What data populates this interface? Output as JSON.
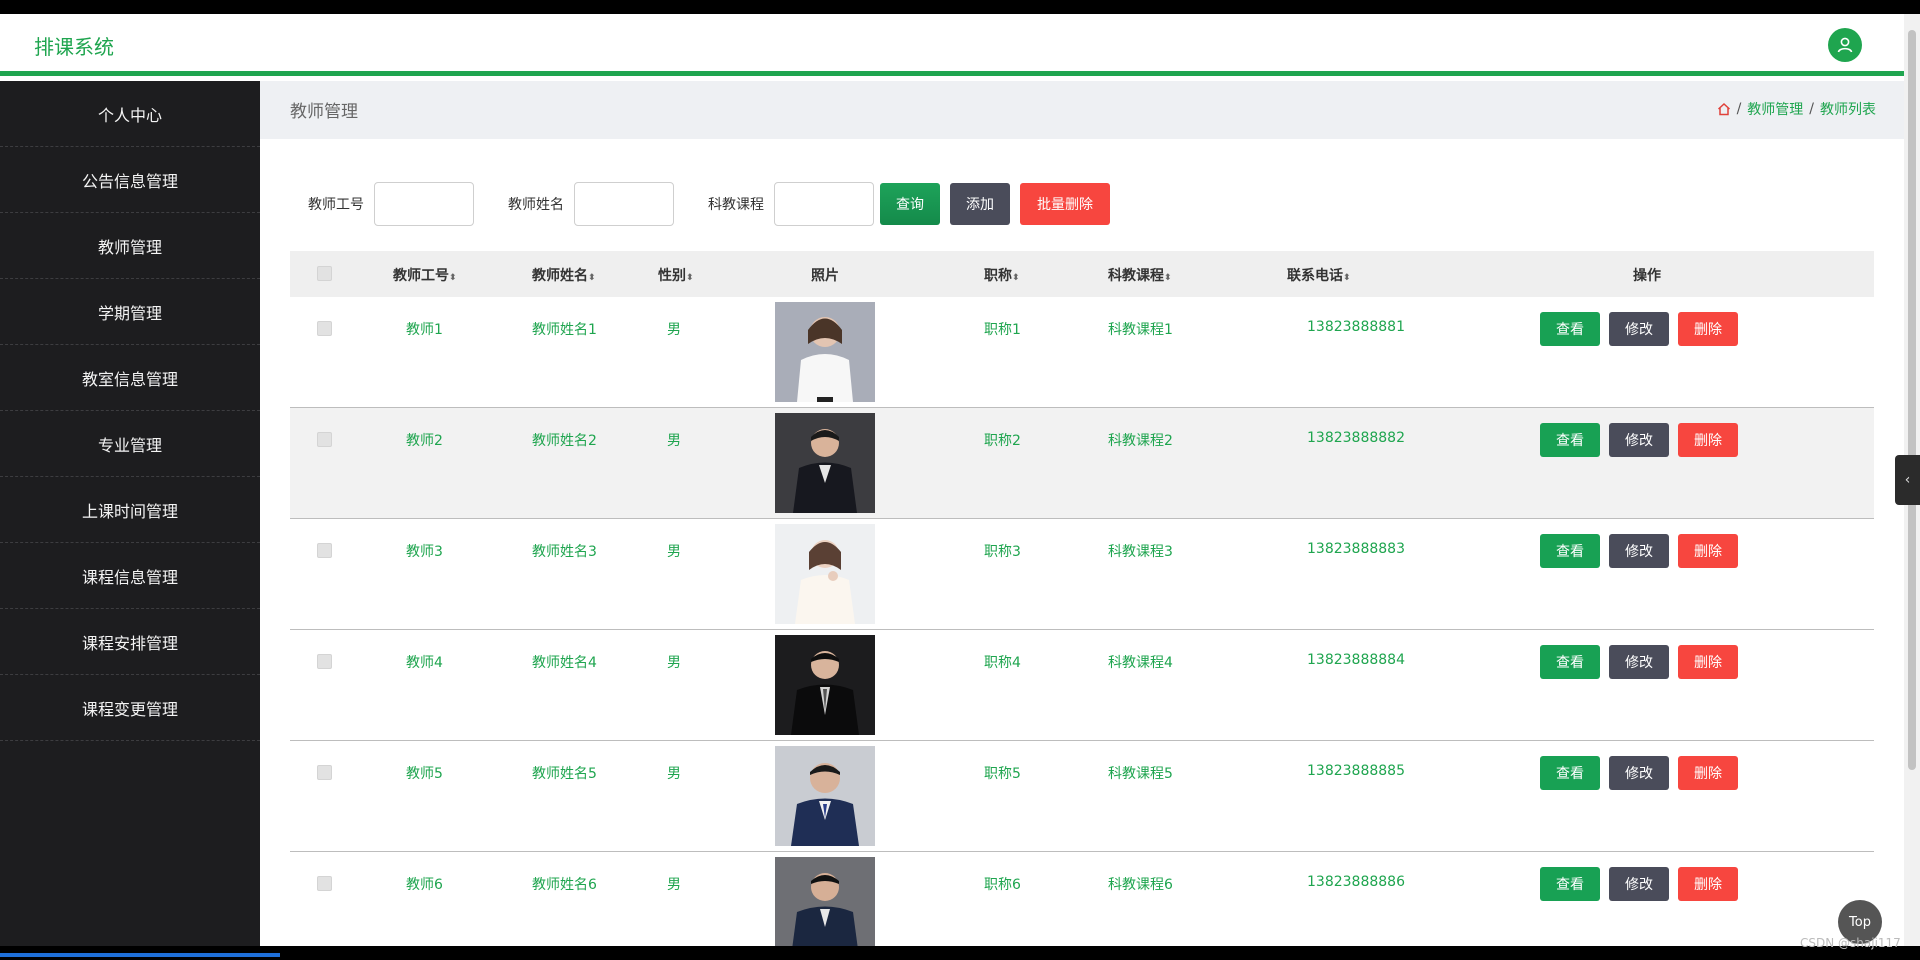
{
  "app": {
    "title": "排课系统"
  },
  "sidebar": {
    "items": [
      {
        "label": "个人中心"
      },
      {
        "label": "公告信息管理"
      },
      {
        "label": "教师管理"
      },
      {
        "label": "学期管理"
      },
      {
        "label": "教室信息管理"
      },
      {
        "label": "专业管理"
      },
      {
        "label": "上课时间管理"
      },
      {
        "label": "课程信息管理"
      },
      {
        "label": "课程安排管理"
      },
      {
        "label": "课程变更管理"
      }
    ]
  },
  "page": {
    "title": "教师管理",
    "breadcrumb": [
      "教师管理",
      "教师列表"
    ],
    "breadcrumb_sep": "/"
  },
  "search": {
    "fields": [
      {
        "label": "教师工号",
        "value": ""
      },
      {
        "label": "教师姓名",
        "value": ""
      },
      {
        "label": "科教课程",
        "value": ""
      }
    ],
    "query_label": "查询",
    "add_label": "添加",
    "batch_delete_label": "批量删除"
  },
  "table": {
    "columns": [
      "教师工号",
      "教师姓名",
      "性别",
      "照片",
      "职称",
      "科教课程",
      "联系电话",
      "操作"
    ],
    "sort_glyph": "⬍",
    "rows": [
      {
        "id": "教师1",
        "name": "教师姓名1",
        "gender": "男",
        "title": "职称1",
        "course": "科教课程1",
        "phone": "13823888881"
      },
      {
        "id": "教师2",
        "name": "教师姓名2",
        "gender": "男",
        "title": "职称2",
        "course": "科教课程2",
        "phone": "13823888882"
      },
      {
        "id": "教师3",
        "name": "教师姓名3",
        "gender": "男",
        "title": "职称3",
        "course": "科教课程3",
        "phone": "13823888883"
      },
      {
        "id": "教师4",
        "name": "教师姓名4",
        "gender": "男",
        "title": "职称4",
        "course": "科教课程4",
        "phone": "13823888884"
      },
      {
        "id": "教师5",
        "name": "教师姓名5",
        "gender": "男",
        "title": "职称5",
        "course": "科教课程5",
        "phone": "13823888885"
      },
      {
        "id": "教师6",
        "name": "教师姓名6",
        "gender": "男",
        "title": "职称6",
        "course": "科教课程6",
        "phone": "13823888886"
      }
    ],
    "actions": {
      "view": "查看",
      "edit": "修改",
      "delete": "删除"
    }
  },
  "floating": {
    "top_label": "Top",
    "watermark": "CSDN @shaji117"
  },
  "colors": {
    "accent": "#1fa54f",
    "sidebar_bg": "#1d1d1f",
    "danger": "#f7463f",
    "neutral": "#4a4c5a"
  },
  "icons": {
    "user": "user-icon",
    "home": "home-icon",
    "collapse": "chevron-left-icon"
  }
}
